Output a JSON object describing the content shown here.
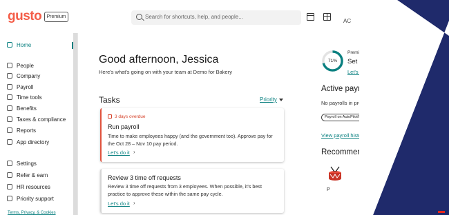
{
  "app": {
    "logo": "gusto",
    "plan_badge": "Premium"
  },
  "topbar": {
    "search_placeholder": "Search for shortcuts, help, and people...",
    "account_initials": "AC",
    "icons": [
      "calendar-icon",
      "gift-icon",
      "search-icon"
    ]
  },
  "sidebar": {
    "items": [
      {
        "label": "Home",
        "active": true
      },
      {
        "label": "People"
      },
      {
        "label": "Company"
      },
      {
        "label": "Payroll"
      },
      {
        "label": "Time tools"
      },
      {
        "label": "Benefits"
      },
      {
        "label": "Taxes & compliance"
      },
      {
        "label": "Reports"
      },
      {
        "label": "App directory"
      },
      {
        "label": "Settings"
      },
      {
        "label": "Refer & earn"
      },
      {
        "label": "HR resources"
      },
      {
        "label": "Priority support"
      }
    ],
    "footer": "Terms, Privacy, & Cookies"
  },
  "main": {
    "greeting": "Good afternoon, Jessica",
    "subtitle": "Here's what's going on with your team at Demo for Bakery",
    "tasks_title": "Tasks",
    "sort_label": "Priority",
    "tasks": [
      {
        "badge": "3 days overdue",
        "title": "Run payroll",
        "description": "Time to make employees happy (and the government too). Approve pay for the Oct 28 – Nov 10 pay period.",
        "link": "Let's do it"
      },
      {
        "title": "Review 3 time off requests",
        "description": "Review 3 time off requests from 3 employees. When possible, it's best practice to approve these within the same pay cycle.",
        "link": "Let's do it"
      }
    ]
  },
  "right": {
    "plan": {
      "progress_percent": 71,
      "progress_label": "71%",
      "label": "Premium plan",
      "title": "Set up your ac",
      "link": "Let's do it"
    },
    "active_payrolls": {
      "title": "Active payrolls",
      "status": "No payrolls in progress.",
      "autopilot_pill": "Payroll on AutoPilot® is OFF",
      "info_icon": "i",
      "history_link": "View payroll history"
    },
    "recommended": {
      "title": "Recommende",
      "item_letter": "P"
    }
  },
  "colors": {
    "brand": "#f45d48",
    "link": "#0a8080",
    "overdue": "#d6432b",
    "diagonal_navy": "#1f2a6b"
  }
}
